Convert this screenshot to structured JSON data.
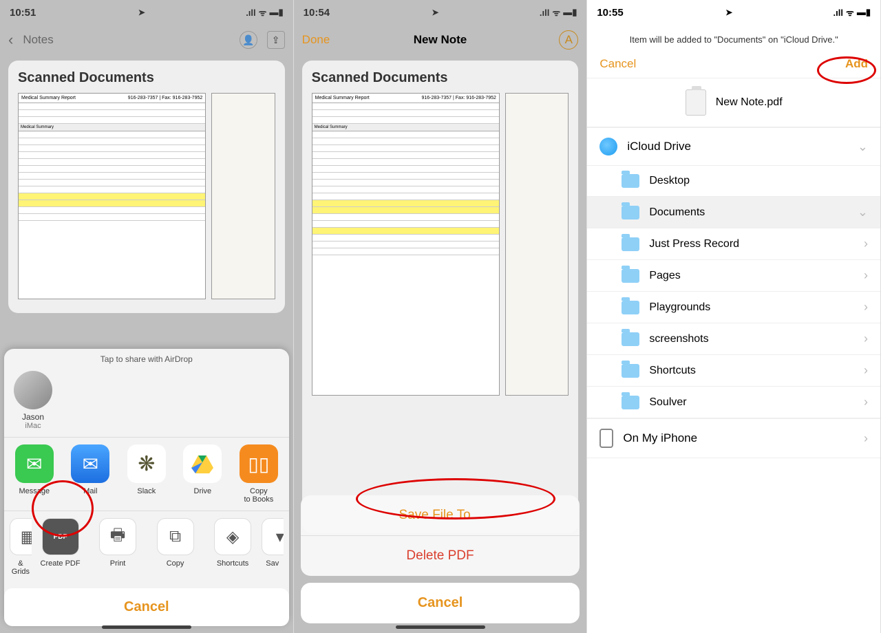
{
  "p1": {
    "time": "10:51",
    "nav_back": "Notes",
    "doc_title": "Scanned Documents",
    "airdrop_caption": "Tap to share with AirDrop",
    "contact": {
      "name": "Jason",
      "device": "iMac"
    },
    "apps": {
      "message": "Message",
      "mail": "Mail",
      "slack": "Slack",
      "drive": "Drive",
      "books": "Copy\nto Books"
    },
    "actions": {
      "grids": "& Grids",
      "create_pdf": "Create PDF",
      "print": "Print",
      "copy": "Copy",
      "shortcuts": "Shortcuts",
      "save": "Sav"
    },
    "cancel": "Cancel"
  },
  "p2": {
    "time": "10:54",
    "done": "Done",
    "title": "New Note",
    "doc_title": "Scanned Documents",
    "save_to": "Save File To...",
    "delete": "Delete PDF",
    "cancel": "Cancel"
  },
  "p3": {
    "time": "10:55",
    "info": "Item will be added to \"Documents\" on \"iCloud Drive.\"",
    "cancel": "Cancel",
    "add": "Add",
    "file": "New Note.pdf",
    "icloud": "iCloud Drive",
    "folders": {
      "desktop": "Desktop",
      "documents": "Documents",
      "jpr": "Just Press Record",
      "pages": "Pages",
      "playgrounds": "Playgrounds",
      "screenshots": "screenshots",
      "shortcuts": "Shortcuts",
      "soulver": "Soulver"
    },
    "on_device": "On My iPhone"
  },
  "doc": {
    "report_title": "Medical Summary Report",
    "phone": "916-283-7357 | Fax: 916-283-7952",
    "section": "Medical Summary"
  }
}
